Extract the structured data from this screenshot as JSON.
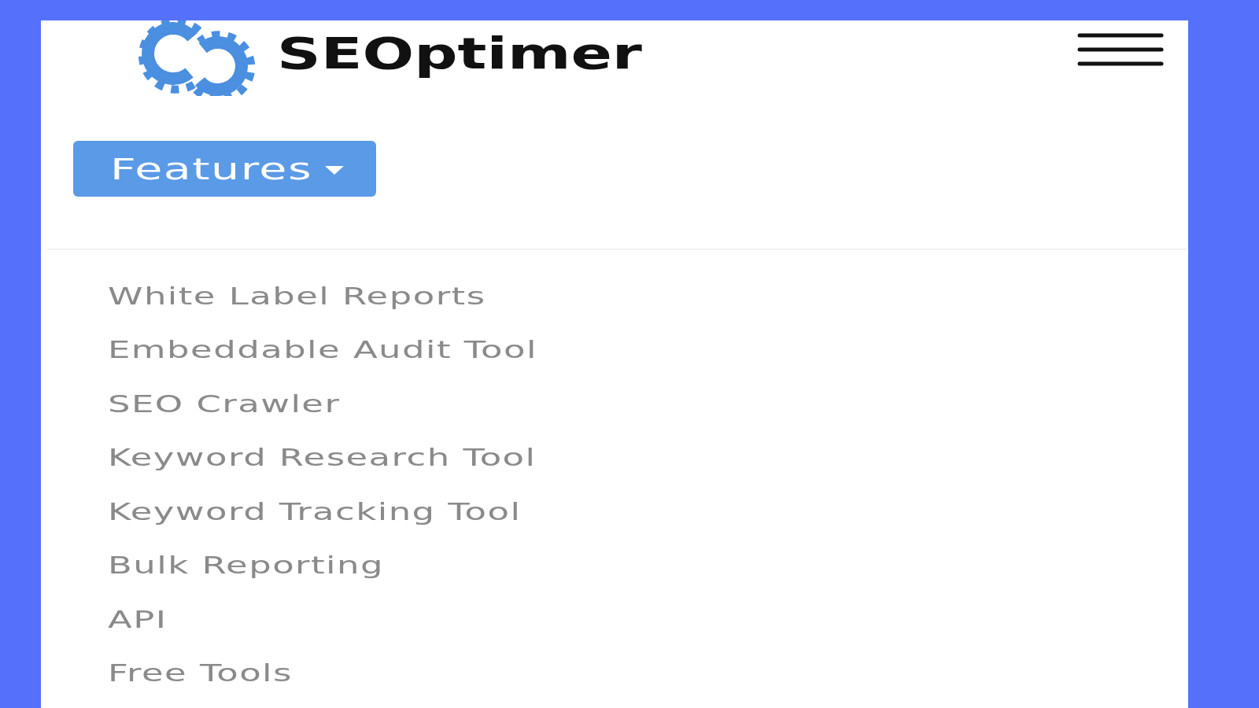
{
  "header": {
    "logo_text": "SEOptimer"
  },
  "features_button": {
    "label": "Features"
  },
  "menu_items": [
    {
      "label": "White Label Reports"
    },
    {
      "label": "Embeddable Audit Tool"
    },
    {
      "label": "SEO Crawler"
    },
    {
      "label": "Keyword Research Tool"
    },
    {
      "label": "Keyword Tracking Tool"
    },
    {
      "label": "Bulk Reporting"
    },
    {
      "label": "API"
    },
    {
      "label": "Free Tools"
    }
  ]
}
